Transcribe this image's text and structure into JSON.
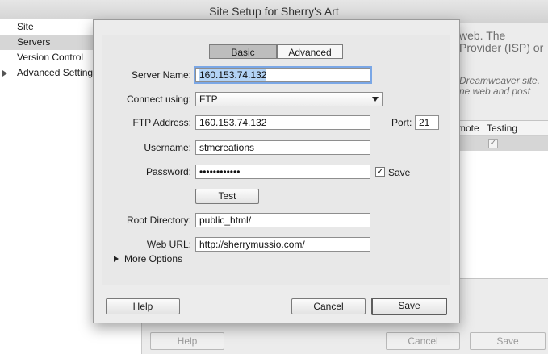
{
  "window": {
    "title": "Site Setup for Sherry's Art"
  },
  "sidebar": {
    "items": [
      {
        "label": "Site"
      },
      {
        "label": "Servers"
      },
      {
        "label": "Version Control"
      },
      {
        "label": "Advanced Settings"
      }
    ]
  },
  "background": {
    "line1": "web. The",
    "line2": "Provider (ISP) or",
    "line3": "Dreamweaver site.",
    "line4": "ne web and post",
    "col_remote": "mote",
    "col_testing": "Testing",
    "help_label": "Help",
    "cancel_label": "Cancel",
    "save_label": "Save"
  },
  "dialog": {
    "tabs": {
      "basic": "Basic",
      "advanced": "Advanced"
    },
    "labels": {
      "server_name": "Server Name:",
      "connect_using": "Connect using:",
      "ftp_address": "FTP Address:",
      "port": "Port:",
      "username": "Username:",
      "password": "Password:",
      "save": "Save",
      "root_directory": "Root Directory:",
      "web_url": "Web URL:",
      "more_options": "More Options"
    },
    "values": {
      "server_name": "160.153.74.132",
      "connect_using": "FTP",
      "ftp_address": "160.153.74.132",
      "port": "21",
      "username": "stmcreations",
      "password": "••••••••••••",
      "root_directory": "public_html/",
      "web_url": "http://sherrymussio.com/"
    },
    "buttons": {
      "test": "Test",
      "help": "Help",
      "cancel": "Cancel",
      "save": "Save"
    }
  }
}
